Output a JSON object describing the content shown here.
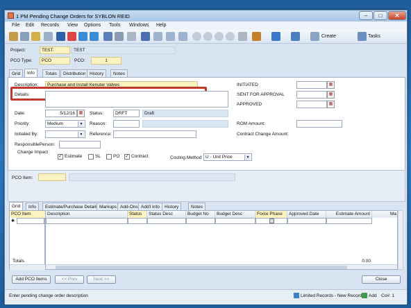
{
  "window": {
    "title": "1 PM Pending Change Orders for SYBLON REID",
    "minimize": "–",
    "maximize": "□",
    "close": "✕"
  },
  "menu": [
    "File",
    "Edit",
    "Records",
    "View",
    "Options",
    "Tools",
    "Windows",
    "Help"
  ],
  "toolbar": {
    "create_label": "Create",
    "tasks_label": "Tasks"
  },
  "header": {
    "project_label": "Project:",
    "project_value": "TEST.",
    "project_desc": "TEST",
    "pco_type_label": "PCO Type:",
    "pco_type_value": "PCO",
    "pco_label": "PCO:",
    "pco_value": "1"
  },
  "top_tabs": [
    "Grid",
    "Info",
    "Totals",
    "Distribution",
    "History",
    "Notes"
  ],
  "info": {
    "description_label": "Description:",
    "description_value": "Purchase and Install Kenuter Valves",
    "details_label": "Details:",
    "date_label": "Date:",
    "date_value": "5/12/16",
    "status_label": "Status:",
    "status_code": "DRFT",
    "status_desc": "Draft",
    "priority_label": "Priority:",
    "priority_value": "Medium",
    "reason_label": "Reason:",
    "initiated_by_label": "Initiated By:",
    "reference_label": "Reference:",
    "responsible_label": "ResponsiblePerson:",
    "change_impact_label": "Change Impact",
    "impact": [
      {
        "label": "Estimate",
        "checked": true
      },
      {
        "label": "SL",
        "checked": false
      },
      {
        "label": "PO",
        "checked": false
      },
      {
        "label": "Contract",
        "checked": true
      }
    ],
    "costing_method_label": "Costing Method",
    "costing_method_value": "U - Unit Price",
    "initiated_label": "INITIATED",
    "sent_label": "SENT FOR APPROVAL",
    "approved_label": "APPROVED",
    "rom_label": "ROM Amount:",
    "contract_change_label": "Contract Change Amount:"
  },
  "pco_item": {
    "label": "PCO Item:"
  },
  "bottom_tabs": [
    "Grid",
    "Info",
    "Estimate/Purchase Details",
    "Markups",
    "Add-Ons",
    "Add'l Info",
    "History",
    "Notes"
  ],
  "grid": {
    "left_header": "PCO Item",
    "columns": [
      "Description",
      "Status",
      "Status Desc",
      "Budget No",
      "Budget Desc",
      "Force Phase",
      "Approved Date",
      "Estimate Amount",
      "Ma"
    ],
    "totals_label": "Totals",
    "total_estimate": "0.00"
  },
  "buttons": {
    "add_pco_items": "Add PCO Items",
    "prev": "<< Prev",
    "next": "Next >>",
    "close": "Close"
  },
  "statusbar": {
    "message": "Enter pending change order description",
    "limited": "Limited Records - New Record",
    "add": "Add",
    "co_number": "Co#: 1"
  }
}
